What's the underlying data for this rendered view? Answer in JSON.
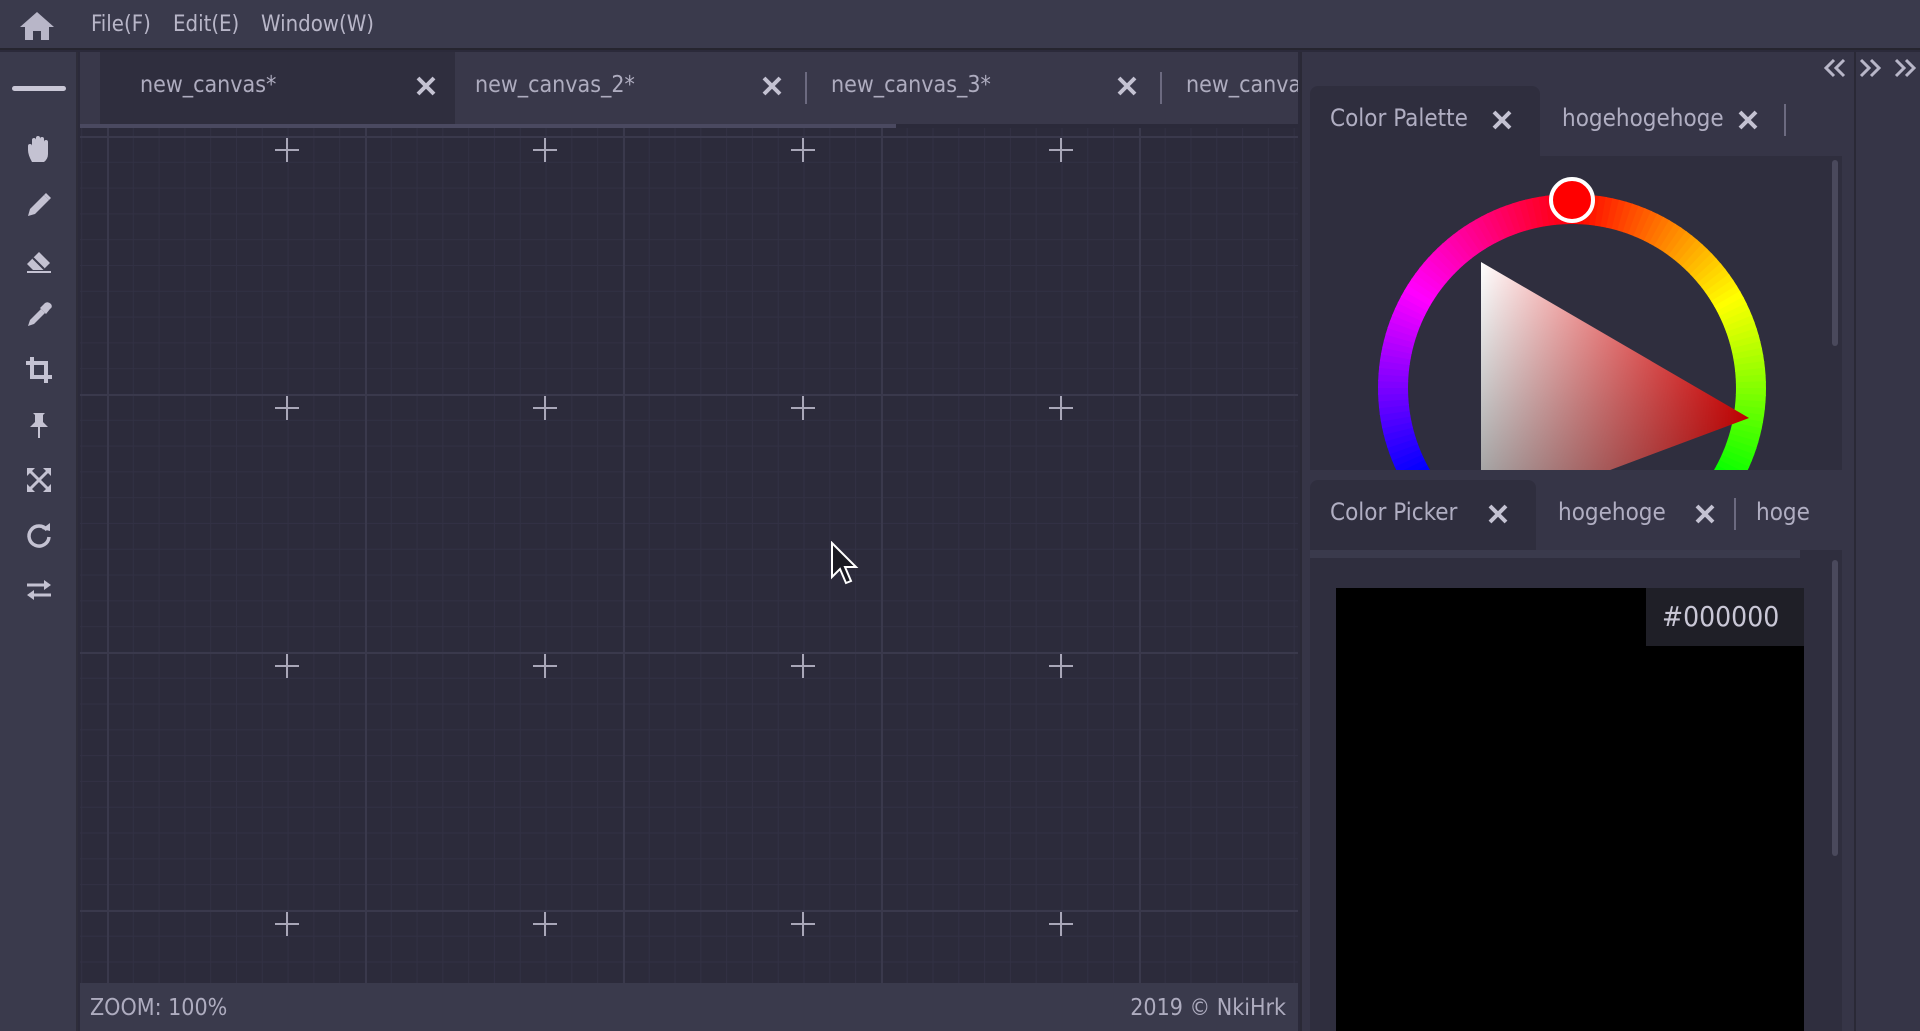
{
  "menu": {
    "items": [
      {
        "label": "File(F)"
      },
      {
        "label": "Edit(E)"
      },
      {
        "label": "Window(W)"
      }
    ]
  },
  "toolbar": {
    "tools": [
      "hand-icon",
      "pencil-icon",
      "eraser-icon",
      "eyedropper-icon",
      "crop-icon",
      "pin-icon",
      "fit-icon",
      "rotate-icon",
      "swap-icon"
    ]
  },
  "document_tabs": [
    {
      "label": "new_canvas*",
      "active": true
    },
    {
      "label": "new_canvas_2*",
      "active": false
    },
    {
      "label": "new_canvas_3*",
      "active": false
    },
    {
      "label": "new_canvas",
      "active": false
    }
  ],
  "status": {
    "zoom": "ZOOM: 100%",
    "copyright": "2019 © NkiHrk"
  },
  "palette_panel": {
    "tabs": [
      {
        "label": "Color Palette",
        "active": true
      },
      {
        "label": "hogehogehoge",
        "active": false
      }
    ]
  },
  "picker_panel": {
    "tabs": [
      {
        "label": "Color Picker",
        "active": true
      },
      {
        "label": "hogehoge",
        "active": false
      },
      {
        "label": "hoge",
        "active": false
      }
    ],
    "hex_value": "#000000"
  },
  "colors": {
    "background": "#2b2a3a",
    "panel": "#363547",
    "selected_hue": "#ff0000",
    "picked_color": "#000000"
  }
}
